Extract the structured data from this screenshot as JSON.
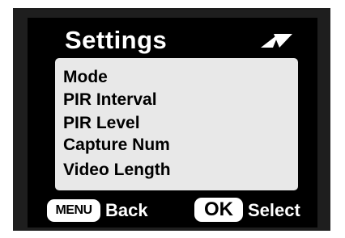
{
  "header": {
    "title": "Settings",
    "nav_icon": "up-down-arrows-icon"
  },
  "menu": {
    "items": [
      {
        "label": "Mode"
      },
      {
        "label": "PIR Interval"
      },
      {
        "label": "PIR Level"
      },
      {
        "label": "Capture Num"
      },
      {
        "label": "Video Length"
      }
    ]
  },
  "footer": {
    "back_key": "MENU",
    "back_label": "Back",
    "select_key": "OK",
    "select_label": "Select"
  },
  "colors": {
    "background": "#000000",
    "panel": "#e8e8e8",
    "text_dark": "#000000",
    "text_light": "#ffffff"
  }
}
